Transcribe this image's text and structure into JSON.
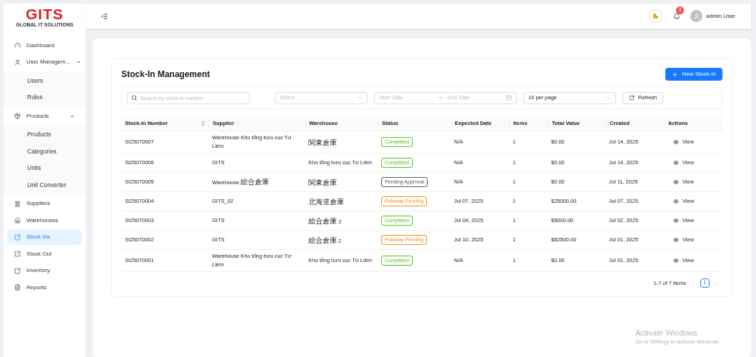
{
  "logo": {
    "name": "GITS",
    "tagline": "GLOBAL IT SOLUTIONS"
  },
  "header": {
    "notification_count": "3",
    "user": "admin User"
  },
  "sidebar": {
    "items": [
      {
        "label": "Dashboard",
        "selected": false
      },
      {
        "label": "User Managem...",
        "selected": false,
        "expanded": true,
        "children": [
          {
            "label": "Users",
            "selected": false
          },
          {
            "label": "Roles",
            "selected": false
          }
        ]
      },
      {
        "label": "Products",
        "selected": false,
        "expanded": true,
        "children": [
          {
            "label": "Products",
            "selected": false
          },
          {
            "label": "Categories",
            "selected": false
          },
          {
            "label": "Units",
            "selected": false
          },
          {
            "label": "Unit Converter",
            "selected": false
          }
        ]
      },
      {
        "label": "Suppliers",
        "selected": false
      },
      {
        "label": "Warehouses",
        "selected": false
      },
      {
        "label": "Stock Ins",
        "selected": true
      },
      {
        "label": "Stock Out",
        "selected": false
      },
      {
        "label": "Inventory",
        "selected": false
      },
      {
        "label": "Reports",
        "selected": false
      }
    ]
  },
  "page": {
    "title": "Stock-In Management",
    "new_button": "New Stock-In"
  },
  "filters": {
    "search": {
      "placeholder": "Search by stock-in number"
    },
    "status": {
      "placeholder": "Status"
    },
    "start_date": {
      "placeholder": "Start Date"
    },
    "end_date": {
      "placeholder": "End Date"
    },
    "page_size": {
      "value": "10 per page"
    },
    "refresh": "Refresh"
  },
  "table": {
    "columns": [
      "Stock-In Number",
      "Supplier",
      "Warehouse",
      "Status",
      "Expected Date",
      "Items",
      "Total Value",
      "Created",
      "Actions"
    ],
    "rows": [
      {
        "number": "SI25070007",
        "supplier": "Warehouse Kho tổng bưu cục Từ Liêm",
        "warehouse": "関東倉庫",
        "status": "Completed",
        "color": "#52c41a",
        "expected": "N/A",
        "items": "1",
        "total": "$0.00",
        "created": "Jul 14, 2025",
        "action": "View"
      },
      {
        "number": "SI25070006",
        "supplier": "GITS",
        "warehouse": "Kho tổng bưu cục Từ Liêm",
        "status": "Completed",
        "color": "#52c41a",
        "expected": "N/A",
        "items": "1",
        "total": "$0.00",
        "created": "Jul 14, 2025",
        "action": "View"
      },
      {
        "number": "SI25070005",
        "supplier": "Warehouse 総合倉庫",
        "warehouse": "関東倉庫",
        "status": "Pending Approval",
        "color": "#595959",
        "expected": "N/A",
        "items": "1",
        "total": "$0.00",
        "created": "Jul 11, 2025",
        "action": "View"
      },
      {
        "number": "SI25070004",
        "supplier": "GITS_02",
        "warehouse": "北海道倉庫",
        "status": "Putaway Pending",
        "color": "#fa8c16",
        "expected": "Jul 07, 2025",
        "items": "1",
        "total": "$25000.00",
        "created": "Jul 07, 2025",
        "action": "View"
      },
      {
        "number": "SI25070003",
        "supplier": "GITS",
        "warehouse": "総合倉庫 2",
        "status": "Completed",
        "color": "#52c41a",
        "expected": "Jul 04, 2025",
        "items": "1",
        "total": "$5000.00",
        "created": "Jul 02, 2025",
        "action": "View"
      },
      {
        "number": "SI25070002",
        "supplier": "GITS",
        "warehouse": "総合倉庫 2",
        "status": "Putaway Pending",
        "color": "#fa8c16",
        "expected": "Jul 10, 2025",
        "items": "1",
        "total": "$82500.00",
        "created": "Jul 01, 2025",
        "action": "View"
      },
      {
        "number": "SI25070001",
        "supplier": "Warehouse Kho tổng bưu cục Từ Liêm",
        "warehouse": "Kho tổng bưu cục Từ Liêm",
        "status": "Completed",
        "color": "#52c41a",
        "expected": "N/A",
        "items": "1",
        "total": "$0.00",
        "created": "Jul 01, 2025",
        "action": "View"
      }
    ]
  },
  "pagination": {
    "summary": "1-7 of 7 items",
    "pages": [
      {
        "label": "1",
        "selected": true
      }
    ]
  },
  "os_watermark": {
    "title": "Activate Windows",
    "subtitle": "Go to Settings to activate Windows."
  }
}
